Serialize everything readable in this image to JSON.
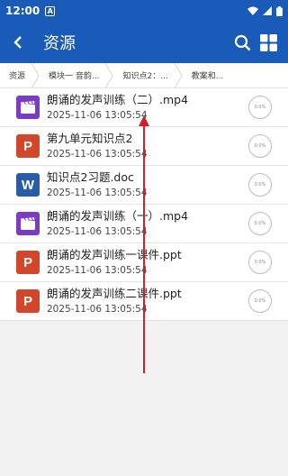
{
  "status": {
    "time": "12:00",
    "badge": "A"
  },
  "header": {
    "title": "资源"
  },
  "breadcrumbs": [
    "资源",
    "模块一 音韵...",
    "知识点2：...",
    "教案和..."
  ],
  "files": [
    {
      "name": "朗诵的发声训练（二）.mp4",
      "date": "2025-11-06 13:05:54",
      "type": "video",
      "progress": "0.0%"
    },
    {
      "name": "第九单元知识点2",
      "date": "2025-11-06 13:05:54",
      "type": "ppt",
      "progress": "0.0%"
    },
    {
      "name": "知识点2习题.doc",
      "date": "2025-11-06 13:05:54",
      "type": "doc",
      "progress": "0.0%"
    },
    {
      "name": "朗诵的发声训练（一）.mp4",
      "date": "2025-11-06 13:05:54",
      "type": "video",
      "progress": "0.0%"
    },
    {
      "name": "朗诵的发声训练一课件.ppt",
      "date": "2025-11-06 13:05:54",
      "type": "ppt",
      "progress": "0.0%"
    },
    {
      "name": "朗诵的发声训练二课件.ppt",
      "date": "2025-11-06 13:05:54",
      "type": "ppt",
      "progress": "0.0%"
    }
  ],
  "icon_letters": {
    "ppt": "P",
    "doc": "W"
  },
  "colors": {
    "appbar": "#1a5ab8",
    "video": "#7a3cc3",
    "ppt": "#d2472b",
    "doc": "#2a5ba8",
    "arrow": "#d0202a"
  }
}
